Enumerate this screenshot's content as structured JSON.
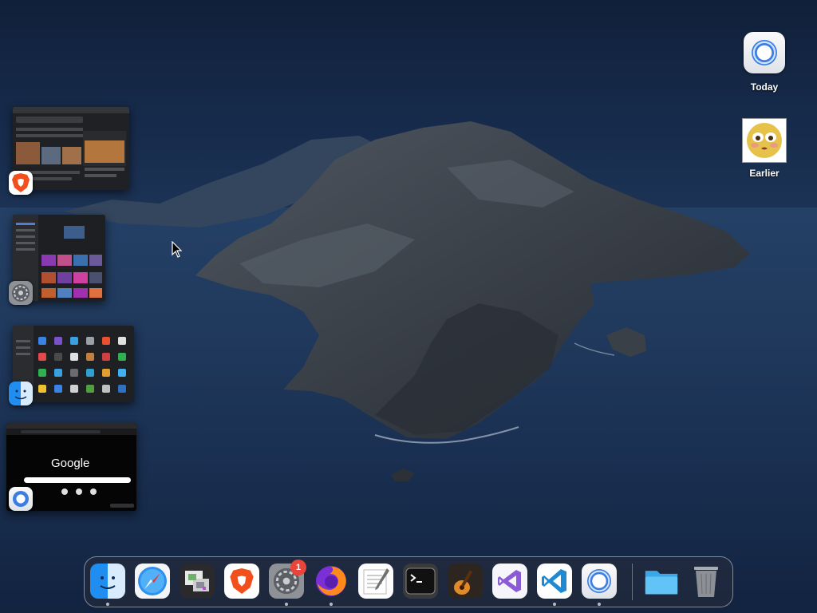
{
  "desktop": {
    "icons": [
      {
        "label": "Today",
        "icon": "chrome-icon"
      },
      {
        "label": "Earlier",
        "icon": "photo-thumbnail"
      }
    ]
  },
  "previews": [
    {
      "app": "Brave",
      "icon": "brave-icon"
    },
    {
      "app": "System Preferences",
      "icon": "system-preferences-icon"
    },
    {
      "app": "Finder",
      "icon": "finder-icon"
    },
    {
      "app": "Chrome",
      "icon": "chrome-icon",
      "google_label": "Google"
    }
  ],
  "dock": {
    "apps": [
      "finder",
      "safari",
      "preview",
      "brave",
      "system-preferences",
      "firefox",
      "textedit",
      "terminal",
      "garageband",
      "visual-studio",
      "vscode",
      "chrome",
      "downloads-folder",
      "trash"
    ],
    "badge_count": "1"
  },
  "colors": {
    "accent": "#3b7de0",
    "badge": "#e8453c"
  }
}
